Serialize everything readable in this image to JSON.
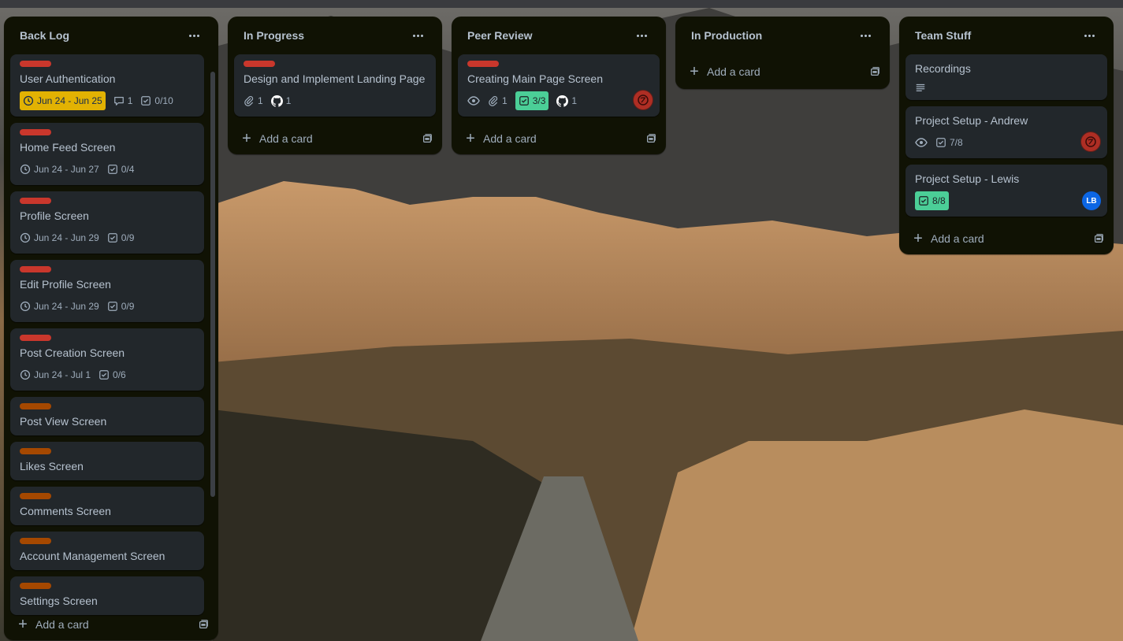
{
  "colors": {
    "list_bg": "#101204",
    "card_bg": "#22272b",
    "label_red": "#c9372c",
    "label_orange": "#a54800",
    "due_warning": "#e2b203",
    "checklist_done": "#4bce97",
    "avatar_red": "#ae2e24",
    "avatar_blue": "#0c66e4"
  },
  "icons": {
    "clock": "clock-icon",
    "comment": "comment-icon",
    "checklist": "checklist-icon",
    "attachment": "paperclip-icon",
    "github": "github-icon",
    "watch": "eye-icon",
    "description": "description-icon",
    "template": "card-template-icon",
    "menu": "more-dots-icon"
  },
  "add_card_label": "Add a card",
  "lists": [
    {
      "title": "Back Log",
      "cards": [
        {
          "title": "User Authentication",
          "label": "red",
          "due": "Jun 24 - Jun 25",
          "due_warning": true,
          "comments": "1",
          "checklist": "0/10"
        },
        {
          "title": "Home Feed Screen",
          "label": "red",
          "due": "Jun 24 - Jun 27",
          "checklist": "0/4"
        },
        {
          "title": "Profile Screen",
          "label": "red",
          "due": "Jun 24 - Jun 29",
          "checklist": "0/9"
        },
        {
          "title": "Edit Profile Screen",
          "label": "red",
          "due": "Jun 24 - Jun 29",
          "checklist": "0/9"
        },
        {
          "title": "Post Creation Screen",
          "label": "red",
          "due": "Jun 24 - Jul 1",
          "checklist": "0/6"
        },
        {
          "title": "Post View Screen",
          "label": "orange"
        },
        {
          "title": "Likes Screen",
          "label": "orange"
        },
        {
          "title": "Comments Screen",
          "label": "orange"
        },
        {
          "title": "Account Management Screen",
          "label": "orange"
        },
        {
          "title": "Settings Screen",
          "label": "orange"
        }
      ]
    },
    {
      "title": "In Progress",
      "cards": [
        {
          "title": "Design and Implement Landing Page",
          "label": "red",
          "attachments": "1",
          "github": "1"
        }
      ]
    },
    {
      "title": "Peer Review",
      "cards": [
        {
          "title": "Creating Main Page Screen",
          "label": "red",
          "watching": true,
          "attachments": "1",
          "checklist_done": "3/3",
          "github": "1",
          "avatar": "red"
        }
      ]
    },
    {
      "title": "In Production",
      "cards": []
    },
    {
      "title": "Team Stuff",
      "cards": [
        {
          "title": "Recordings",
          "description": true
        },
        {
          "title": "Project Setup - Andrew",
          "watching": true,
          "checklist": "7/8",
          "avatar": "red"
        },
        {
          "title": "Project Setup - Lewis",
          "checklist_done": "8/8",
          "avatar_initials": "LB"
        }
      ]
    }
  ]
}
